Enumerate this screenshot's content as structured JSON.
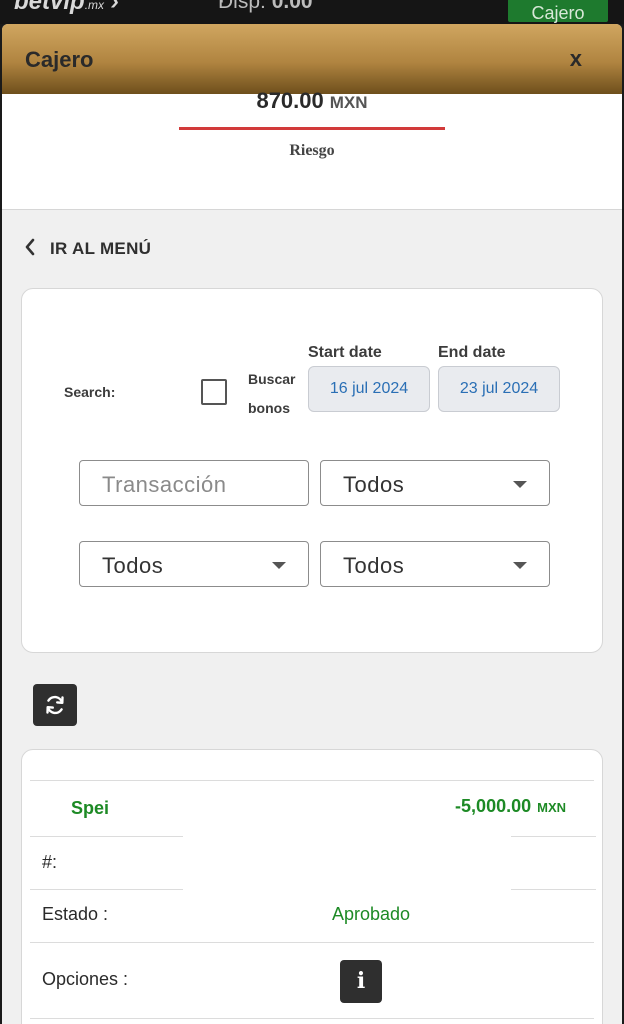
{
  "background_bar": {
    "logo_text": "betvip",
    "logo_suffix": ".mx",
    "disp_label": "Disp:",
    "disp_value": "0.00",
    "cajero_button": "Cajero"
  },
  "modal": {
    "title": "Cajero",
    "close_label": "x"
  },
  "balance": {
    "amount": "870.00",
    "currency": "MXN",
    "label": "Riesgo",
    "bar_color": "#d23a3a"
  },
  "nav": {
    "back_label": "IR AL MENÚ",
    "back_icon": "chevron-left-icon"
  },
  "filters": {
    "search_label": "Search:",
    "buscar_bonos_line1": "Buscar",
    "buscar_bonos_line2": "bonos",
    "buscar_bonos_checked": false,
    "start_date_label": "Start date",
    "start_date_value": "16 jul 2024",
    "end_date_label": "End date",
    "end_date_value": "23 jul 2024",
    "transaction_placeholder": "Transacción",
    "select1_value": "Todos",
    "select2_value": "Todos",
    "select3_value": "Todos"
  },
  "refresh_icon": "refresh-icon",
  "transaction": {
    "type": "Spei",
    "amount": "-5,000.00",
    "currency": "MXN",
    "number_label": "#:",
    "number_value": "",
    "status_label": "Estado :",
    "status_value": "Aprobado",
    "options_label": "Opciones :",
    "options_icon": "info-icon",
    "accent_color": "#1d8a25"
  }
}
